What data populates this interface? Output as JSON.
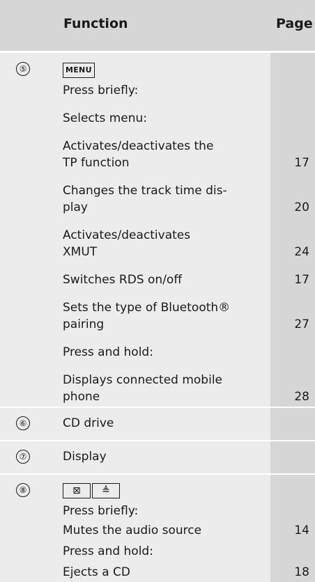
{
  "header": {
    "function": "Function",
    "page": "Page"
  },
  "rows": {
    "r5": {
      "number": "⑤",
      "key": "MENU",
      "lines": [
        "Press briefly:",
        "Selects menu:",
        "Activates/deactivates the",
        "TP function",
        "Changes the track time dis-",
        "play",
        "Activates/deactivates",
        "XMUT",
        "Switches RDS on/off",
        "Sets the type of Bluetooth®",
        "pairing",
        "Press and hold:",
        "Displays connected mobile",
        "phone"
      ],
      "pages": [
        "17",
        "20",
        "24",
        "17",
        "27",
        "28"
      ]
    },
    "r6": {
      "number": "⑥",
      "text": "CD drive"
    },
    "r7": {
      "number": "⑦",
      "text": "Display"
    },
    "r8": {
      "number": "⑧",
      "keys": [
        "⊠",
        "≜"
      ],
      "lines": [
        "Press briefly:",
        "Mutes the audio source",
        "Press and hold:",
        "Ejects a CD"
      ],
      "pages": [
        "14",
        "18"
      ]
    }
  }
}
